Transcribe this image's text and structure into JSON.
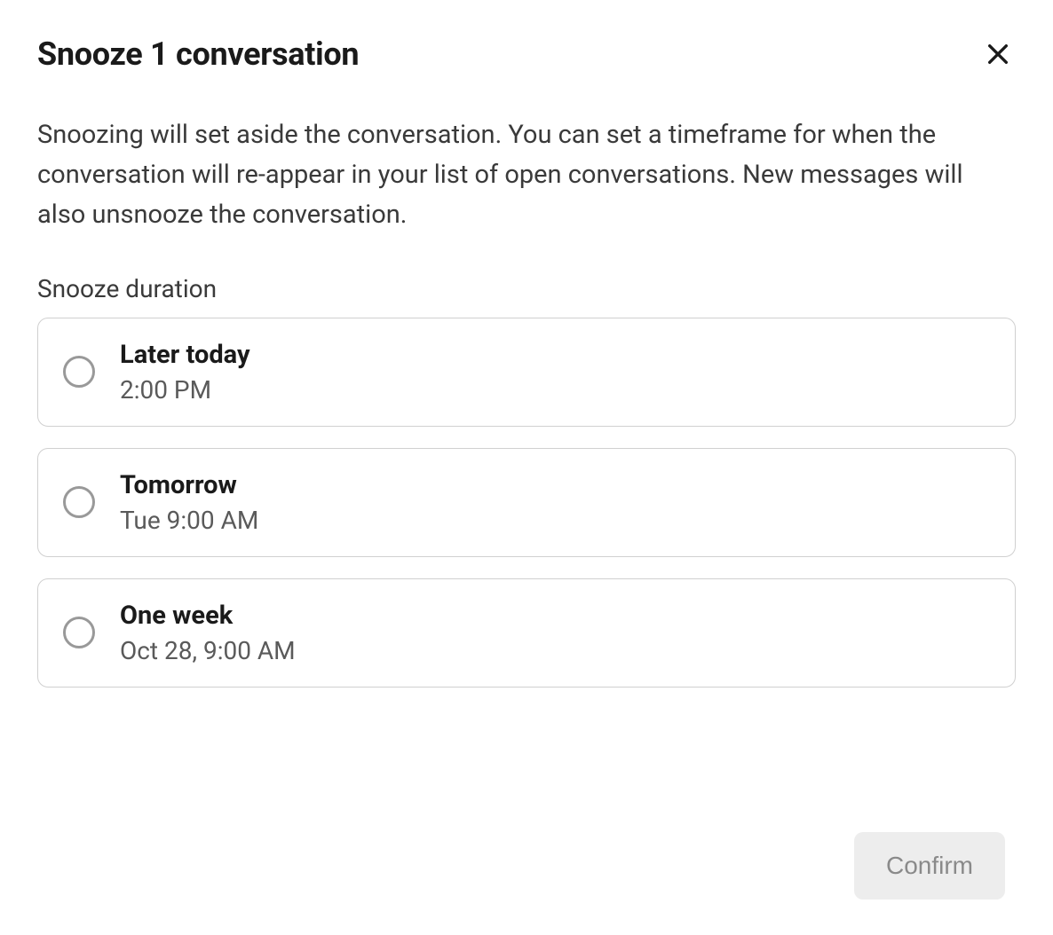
{
  "modal": {
    "title": "Snooze 1 conversation",
    "description": "Snoozing will set aside the conversation. You can set a timeframe for when the conversation will re-appear in your list of open conversations. New messages will also unsnooze the conversation.",
    "section_label": "Snooze duration",
    "options": [
      {
        "title": "Later today",
        "subtitle": "2:00 PM"
      },
      {
        "title": "Tomorrow",
        "subtitle": "Tue 9:00 AM"
      },
      {
        "title": "One week",
        "subtitle": "Oct 28, 9:00 AM"
      }
    ],
    "confirm_label": "Confirm"
  }
}
